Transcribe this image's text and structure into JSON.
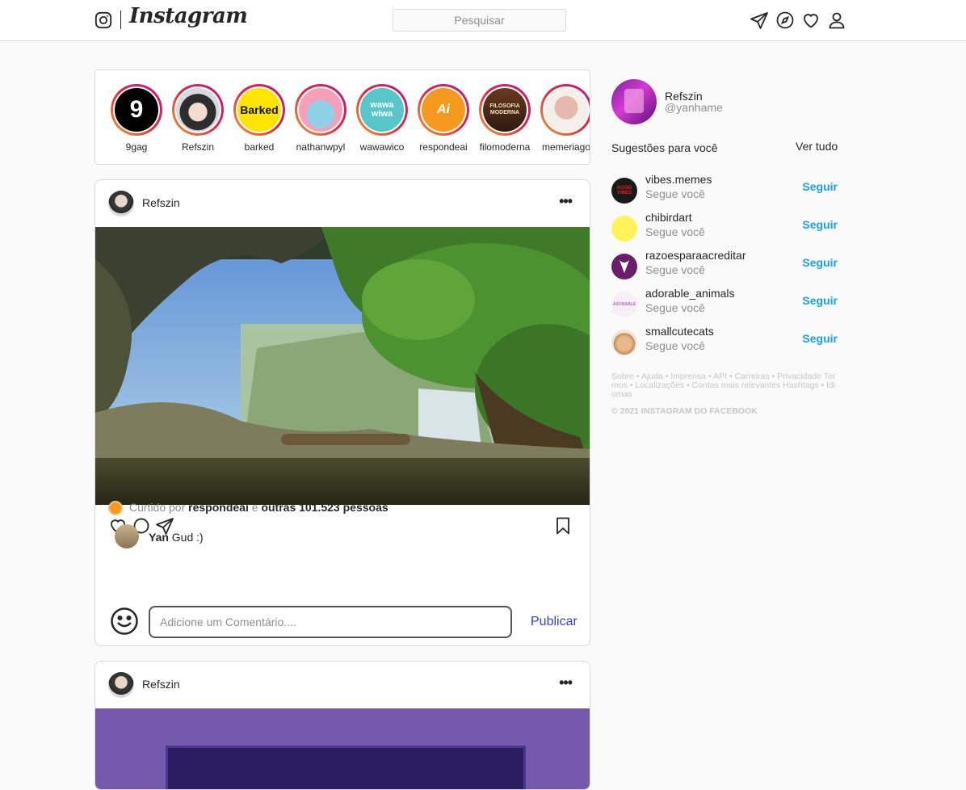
{
  "header": {
    "logo_text": "Instagram",
    "search_placeholder": "Pesquisar",
    "icons": [
      "instagram-glyph-icon",
      "send-icon",
      "compass-icon",
      "heart-icon",
      "user-icon"
    ]
  },
  "stories": [
    {
      "label": "9gag",
      "avatar_text": "9"
    },
    {
      "label": "Refszin",
      "avatar_text": ""
    },
    {
      "label": "barked",
      "avatar_text": "Barked"
    },
    {
      "label": "nathanwpyl",
      "avatar_text": ""
    },
    {
      "label": "wawawico",
      "avatar_text": "wawa wiwa"
    },
    {
      "label": "respondeai",
      "avatar_text": "Ai"
    },
    {
      "label": "filomoderna",
      "avatar_text": "FILOSOFIA MODERNA"
    },
    {
      "label": "memeriago",
      "avatar_text": ""
    }
  ],
  "posts": [
    {
      "user": "Refszin",
      "more": "•••",
      "liked_by_prefix": "Curtido por",
      "liked_by_user": "respondeai",
      "liked_by_joiner": "e",
      "liked_by_rest": "outras 101.523 pessoas",
      "comment_user": "Yan",
      "comment_text": "Gud :)",
      "comment_placeholder": "Adicione um Comentário....",
      "publish_label": "Publicar"
    },
    {
      "user": "Refszin",
      "more": "•••"
    }
  ],
  "sidebar": {
    "name": "Refszin",
    "handle": "@yanhame",
    "suggestions_title": "Sugestões para você",
    "see_all": "Ver tudo",
    "suggestions": [
      {
        "name": "vibes.memes",
        "sub": "Segue você",
        "action": "Seguir",
        "avatar_text": "GOOD VIBES"
      },
      {
        "name": "chibirdart",
        "sub": "Segue você",
        "action": "Seguir",
        "avatar_text": ""
      },
      {
        "name": "razoesparaacreditar",
        "sub": "Segue você",
        "action": "Seguir",
        "avatar_text": ""
      },
      {
        "name": "adorable_animals",
        "sub": "Segue você",
        "action": "Seguir",
        "avatar_text": "ADORABLE"
      },
      {
        "name": "smallcutecats",
        "sub": "Segue você",
        "action": "Seguir",
        "avatar_text": ""
      }
    ],
    "footer_links": "Sobre • Ajuda • Imprensa • API • Carreiras • Privacidade Termos • Localizações • Contas mais relevantes Hashtags • Idiomas",
    "copyright": "© 2021 INSTAGRAM DO FACEBOOK"
  },
  "colors": {
    "link_blue": "#1aa0e8",
    "publish_blue": "#3142d6",
    "border": "#dbdbdb",
    "post2_bg": "#7559ac"
  }
}
